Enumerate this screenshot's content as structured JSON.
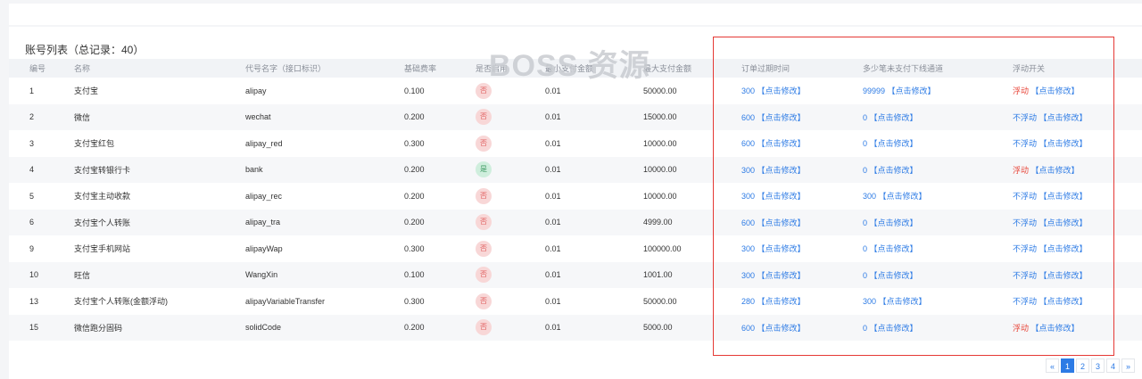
{
  "list": {
    "title": "账号列表（总记录：40）"
  },
  "watermark": "BOSS 资源",
  "columns": [
    "编号",
    "名称",
    "代号名字（接口标识）",
    "基础费率",
    "是否启用",
    "最小支付金额",
    "最大支付金额",
    "订单过期时间",
    "多少笔未支付下线通道",
    "浮动开关"
  ],
  "rows": [
    {
      "id": "1",
      "name": "支付宝",
      "code": "alipay",
      "rate": "0.100",
      "enabled": "否",
      "min": "0.01",
      "max": "50000.00",
      "expire": "300",
      "unpaid": "99999",
      "float": "浮动"
    },
    {
      "id": "2",
      "name": "微信",
      "code": "wechat",
      "rate": "0.200",
      "enabled": "否",
      "min": "0.01",
      "max": "15000.00",
      "expire": "600",
      "unpaid": "0",
      "float": "不浮动"
    },
    {
      "id": "3",
      "name": "支付宝红包",
      "code": "alipay_red",
      "rate": "0.300",
      "enabled": "否",
      "min": "0.01",
      "max": "10000.00",
      "expire": "600",
      "unpaid": "0",
      "float": "不浮动"
    },
    {
      "id": "4",
      "name": "支付宝转银行卡",
      "code": "bank",
      "rate": "0.200",
      "enabled": "是",
      "min": "0.01",
      "max": "10000.00",
      "expire": "300",
      "unpaid": "0",
      "float": "浮动"
    },
    {
      "id": "5",
      "name": "支付宝主动收款",
      "code": "alipay_rec",
      "rate": "0.200",
      "enabled": "否",
      "min": "0.01",
      "max": "10000.00",
      "expire": "300",
      "unpaid": "300",
      "float": "不浮动"
    },
    {
      "id": "6",
      "name": "支付宝个人转账",
      "code": "alipay_tra",
      "rate": "0.200",
      "enabled": "否",
      "min": "0.01",
      "max": "4999.00",
      "expire": "600",
      "unpaid": "0",
      "float": "不浮动"
    },
    {
      "id": "9",
      "name": "支付宝手机网站",
      "code": "alipayWap",
      "rate": "0.300",
      "enabled": "否",
      "min": "0.01",
      "max": "100000.00",
      "expire": "300",
      "unpaid": "0",
      "float": "不浮动"
    },
    {
      "id": "10",
      "name": "旺信",
      "code": "WangXin",
      "rate": "0.100",
      "enabled": "否",
      "min": "0.01",
      "max": "1001.00",
      "expire": "300",
      "unpaid": "0",
      "float": "不浮动"
    },
    {
      "id": "13",
      "name": "支付宝个人转账(金额浮动)",
      "code": "alipayVariableTransfer",
      "rate": "0.300",
      "enabled": "否",
      "min": "0.01",
      "max": "50000.00",
      "expire": "280",
      "unpaid": "300",
      "float": "不浮动"
    },
    {
      "id": "15",
      "name": "微信跑分固码",
      "code": "solidCode",
      "rate": "0.200",
      "enabled": "否",
      "min": "0.01",
      "max": "5000.00",
      "expire": "600",
      "unpaid": "0",
      "float": "浮动"
    }
  ],
  "edit_label": "【点击修改】",
  "pagination": {
    "prev": "«",
    "pages": [
      "1",
      "2",
      "3",
      "4"
    ],
    "active": "1",
    "next": "»"
  },
  "colors": {
    "accent": "#2d7be5",
    "float_on": "#e8473b",
    "highlight_box": "#e53935"
  }
}
